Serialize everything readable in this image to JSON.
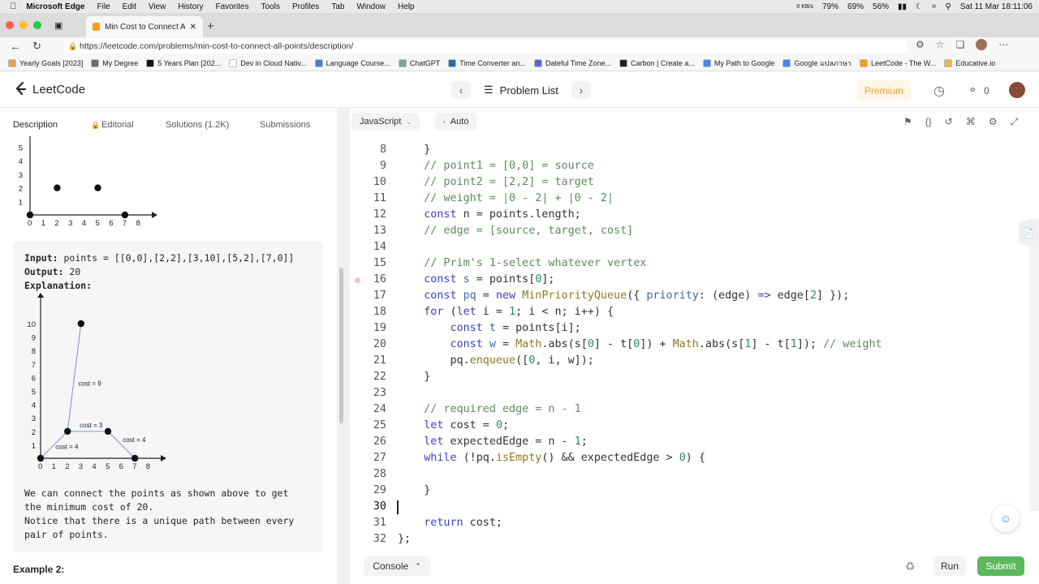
{
  "mac_menu": {
    "apple": "",
    "app": "Microsoft Edge",
    "items": [
      "File",
      "Edit",
      "View",
      "History",
      "Favorites",
      "Tools",
      "Profiles",
      "Tab",
      "Window",
      "Help"
    ],
    "status": {
      "net": "0 KB/s",
      "ssd": "79%",
      "ram": "69%",
      "cpu": "56%",
      "datetime": "Sat 11 Mar  18:11:06"
    }
  },
  "browser": {
    "tab_title": "Min Cost to Connect All Points",
    "url": "https://leetcode.com/problems/min-cost-to-connect-all-points/description/",
    "bookmarks": [
      {
        "label": "Yearly Goals [2023]",
        "color": "#e8a14a"
      },
      {
        "label": "My Degree",
        "color": "#6b6b6b"
      },
      {
        "label": "5 Years Plan [202...",
        "color": "#111111"
      },
      {
        "label": "Dev in Cloud Nativ...",
        "color": "#ffffff"
      },
      {
        "label": "Language Course...",
        "color": "#4a7bd4"
      },
      {
        "label": "ChatGPT",
        "color": "#74aa9c"
      },
      {
        "label": "Time Converter an...",
        "color": "#2b6cb0"
      },
      {
        "label": "Dateful Time Zone...",
        "color": "#5a67d8"
      },
      {
        "label": "Carbon | Create a...",
        "color": "#222222"
      },
      {
        "label": "My Path to Google",
        "color": "#4285f4"
      },
      {
        "label": "Google แปลภาษา",
        "color": "#4285f4"
      },
      {
        "label": "LeetCode - The W...",
        "color": "#f89f1b"
      },
      {
        "label": "Educative.io",
        "color": "#e8b84a"
      }
    ]
  },
  "header": {
    "logo": "LeetCode",
    "problem_list": "Problem List",
    "premium": "Premium",
    "streak": "0"
  },
  "left_tabs": [
    "Description",
    "Editorial",
    "Solutions (1.2K)",
    "Submissions"
  ],
  "chart1": {
    "yticks": [
      "5",
      "4",
      "3",
      "2",
      "1"
    ],
    "xticks": [
      "0",
      "1",
      "2",
      "3",
      "4",
      "5",
      "6",
      "7",
      "8"
    ]
  },
  "example1": {
    "input_label": "Input:",
    "input_value": "points = [[0,0],[2,2],[3,10],[5,2],[7,0]]",
    "output_label": "Output:",
    "output_value": "20",
    "explanation_label": "Explanation:",
    "explanation_lines": [
      "We can connect the points as shown above to get",
      "the minimum cost of 20.",
      "Notice that there is a unique path between every",
      "pair of points."
    ]
  },
  "chart2": {
    "yticks": [
      "10",
      "9",
      "8",
      "7",
      "6",
      "5",
      "4",
      "3",
      "2",
      "1"
    ],
    "xticks": [
      "0",
      "1",
      "2",
      "3",
      "4",
      "5",
      "6",
      "7",
      "8"
    ],
    "edge_labels": [
      "cost = 9",
      "cost = 3",
      "cost = 4",
      "cost = 4"
    ]
  },
  "example2_heading": "Example 2:",
  "editor": {
    "language": "JavaScript",
    "mode": "Auto",
    "cursor_line": 30,
    "breakpoint_line": 16
  },
  "code_lines": [
    {
      "n": "8",
      "h": "    }"
    },
    {
      "n": "9",
      "h": "    <span class='cm'>// point1 = [0,0] = source</span>"
    },
    {
      "n": "10",
      "h": "    <span class='cm'>// point2 = [2,2] = target</span>"
    },
    {
      "n": "11",
      "h": "    <span class='cm'>// weight = |0 - 2| + |0 - 2|</span>"
    },
    {
      "n": "12",
      "h": "    <span class='kw'>const</span> n = points.length;"
    },
    {
      "n": "13",
      "h": "    <span class='cm'>// edge = [source, target, cost]</span>"
    },
    {
      "n": "14",
      "h": ""
    },
    {
      "n": "15",
      "h": "    <span class='cm'>// Prim's 1-select whatever vertex</span>"
    },
    {
      "n": "16",
      "h": "    <span class='kw'>const</span> <span class='pr'>s</span> = points[<span class='num'>0</span>];"
    },
    {
      "n": "17",
      "h": "    <span class='kw'>const</span> <span class='pr'>pq</span> = <span class='kw'>new</span> <span class='fn'>MinPriorityQueue</span>({ <span class='pr'>priority</span>: (edge) <span class='kw'>=&gt;</span> edge[<span class='num'>2</span>] });"
    },
    {
      "n": "18",
      "h": "    <span class='kw'>for</span> (<span class='kw'>let</span> i = <span class='num'>1</span>; i &lt; n; i++) {"
    },
    {
      "n": "19",
      "h": "        <span class='kw'>const</span> <span class='pr'>t</span> = points[i];"
    },
    {
      "n": "20",
      "h": "        <span class='kw'>const</span> <span class='pr'>w</span> = <span class='fn'>Math</span>.abs(s[<span class='num'>0</span>] - t[<span class='num'>0</span>]) + <span class='fn'>Math</span>.abs(s[<span class='num'>1</span>] - t[<span class='num'>1</span>]); <span class='cm'>// weight</span>"
    },
    {
      "n": "21",
      "h": "        pq.<span class='fn'>enqueue</span>([<span class='num'>0</span>, i, w]);"
    },
    {
      "n": "22",
      "h": "    }"
    },
    {
      "n": "23",
      "h": ""
    },
    {
      "n": "24",
      "h": "    <span class='cm'>// required edge = n - 1</span>"
    },
    {
      "n": "25",
      "h": "    <span class='kw'>let</span> cost = <span class='num'>0</span>;"
    },
    {
      "n": "26",
      "h": "    <span class='kw'>let</span> expectedEdge = n - <span class='num'>1</span>;"
    },
    {
      "n": "27",
      "h": "    <span class='kw'>while</span> (!pq.<span class='fn'>isEmpty</span>() &amp;&amp; expectedEdge &gt; <span class='num'>0</span>) {"
    },
    {
      "n": "28",
      "h": ""
    },
    {
      "n": "29",
      "h": "    }"
    },
    {
      "n": "30",
      "h": ""
    },
    {
      "n": "31",
      "h": "    <span class='kw'>return</span> cost;"
    },
    {
      "n": "32",
      "h": "};"
    }
  ],
  "footer": {
    "console": "Console",
    "run": "Run",
    "submit": "Submit"
  },
  "colors": {
    "submit": "#5bb85d",
    "premium": "#f0a12e",
    "comment": "#5a8d5a",
    "keyword": "#3b3fc4"
  }
}
